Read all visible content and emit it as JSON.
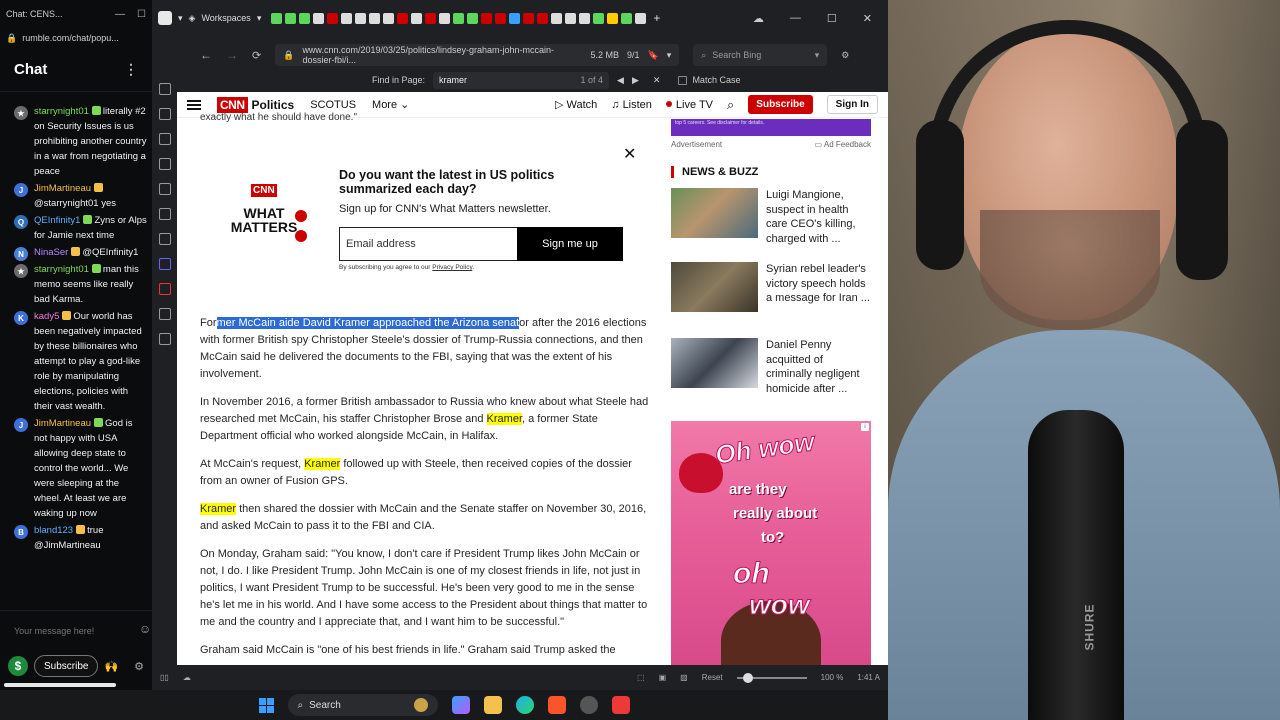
{
  "chat_window": {
    "tab_title": "Chat: CENS...",
    "url": "rumble.com/chat/popu...",
    "header": "Chat",
    "messages": [
      {
        "user": "starrynight01",
        "text": "literally #2 on Security Issues is us prohibiting another country in a war from negotiating a peace",
        "user_color": "#7ed957",
        "avatar_color": "#6b6b6b",
        "avatar": "★"
      },
      {
        "user": "JimMartineau",
        "text": "@starrynight01 yes",
        "user_color": "#f5c04a",
        "avatar_color": "#3f6fd8",
        "avatar": "J"
      },
      {
        "user": "QEInfinity1",
        "text": "Zyns or Alps for Jamie next time",
        "user_color": "#5fb0ff",
        "avatar_color": "#2e6fb8",
        "avatar": "Q"
      },
      {
        "user": "NinaSer",
        "text": "@QEInfinity1",
        "user_color": "#b58cff",
        "avatar_color": "#4a7fd6",
        "avatar": "N"
      },
      {
        "user": "starrynight01",
        "text": "man this memo seems like really bad Karma.",
        "user_color": "#7ed957",
        "avatar_color": "#6b6b6b",
        "avatar": "★"
      },
      {
        "user": "kady5",
        "text": "Our world has been negatively impacted by these billionaires who attempt to play a god-like role by manipulating elections, policies with their vast wealth.",
        "user_color": "#f07ad6",
        "avatar_color": "#3f6fd8",
        "avatar": "K"
      },
      {
        "user": "JimMartineau",
        "text": "God is not happy with USA allowing deep state to control the world... We were sleeping at the wheel. At least we are waking up now",
        "user_color": "#f5c04a",
        "avatar_color": "#3f6fd8",
        "avatar": "J"
      },
      {
        "user": "bland123",
        "text": "true @JimMartineau",
        "user_color": "#5fb0ff",
        "avatar_color": "#3f6fd8",
        "avatar": "B"
      }
    ],
    "input_placeholder": "Your message here!",
    "subscribe_label": "Subscribe",
    "dollar_symbol": "$"
  },
  "browser": {
    "workspaces_label": "Workspaces",
    "url": "www.cnn.com/2019/03/25/politics/lindsey-graham-john-mccain-dossier-fbi/i...",
    "page_size": "5.2 MB",
    "page_count": "9/1",
    "search_placeholder": "Search Bing",
    "find_label": "Find in Page:",
    "find_query": "kramer",
    "find_count": "1 of 4",
    "match_case_label": "Match Case",
    "status_reset": "Reset",
    "status_zoom": "100 %",
    "status_time": "1:41 A"
  },
  "cnn": {
    "logo": "CNN",
    "section": "Politics",
    "nav": [
      "SCOTUS",
      "More"
    ],
    "watch": "Watch",
    "listen": "Listen",
    "live_tv": "Live TV",
    "subscribe": "Subscribe",
    "sign_in": "Sign In",
    "cut_line": "exactly what he should have done.\"",
    "promo": {
      "logo_top": "CNN",
      "logo_words": "WHAT MATTERS",
      "headline": "Do you want the latest in US politics summarized each day?",
      "sub": "Sign up for CNN's What Matters newsletter.",
      "email_placeholder": "Email address",
      "button": "Sign me up",
      "legal": "By subscribing you agree to our",
      "legal_link": "Privacy Policy",
      "legal_end": "."
    },
    "paragraphs": [
      {
        "a": "For",
        "sel": "mer McCain aide David Kramer approached the Arizona senat",
        "b": "or after the 2016 elections with former British spy Christopher Steele's dossier of Trump-Russia connections, and then McCain said he delivered the documents to the FBI, saying that was the extent of his involvement."
      },
      {
        "a": "In November 2016, a former British ambassador to Russia who knew about what Steele had researched met McCain, his staffer Christopher Brose and ",
        "hl": "Kramer",
        "b": ", a former State Department official who worked alongside McCain, in Halifax."
      },
      {
        "a": "At McCain's request, ",
        "hl": "Kramer",
        "b": " followed up with Steele, then received copies of the dossier from an owner of Fusion GPS."
      },
      {
        "a": "",
        "hl": "Kramer",
        "b": " then shared the dossier with McCain and the Senate staffer on November 30, 2016, and asked McCain to pass it to the FBI and CIA."
      },
      {
        "a": "On Monday, Graham said: \"You know, I don't care if President Trump likes John McCain or not, I do. I like President Trump. John McCain is one of my closest friends in life, not just in politics, I want President Trump to be successful. He's been very good to me in the sense he's let me in his world. And I have some access to the President about things that matter to me and the country and I appreciate that, and I want him to be successful.\""
      },
      {
        "a": "Graham said McCain is \"one of his best friends in life.\" Graham said Trump asked the"
      }
    ],
    "ad_label": "Advertisement",
    "ad_feedback": "Ad Feedback",
    "ad_banner_small": "top 5 careers. See disclaimer for details.",
    "news_buzz_title": "NEWS & BUZZ",
    "news_items": [
      {
        "headline": "Luigi Mangione, suspect in health care CEO's killing, charged with ..."
      },
      {
        "headline": "Syrian rebel leader's victory speech holds a message for Iran ..."
      },
      {
        "headline": "Daniel Penny acquitted of criminally negligent homicide after ..."
      }
    ],
    "ad_text": [
      "Oh wow",
      "are they",
      "really about",
      "to?",
      "oh",
      "wow"
    ]
  },
  "taskbar": {
    "search_label": "Search"
  },
  "webcam": {
    "mic_label": "SHURE"
  }
}
